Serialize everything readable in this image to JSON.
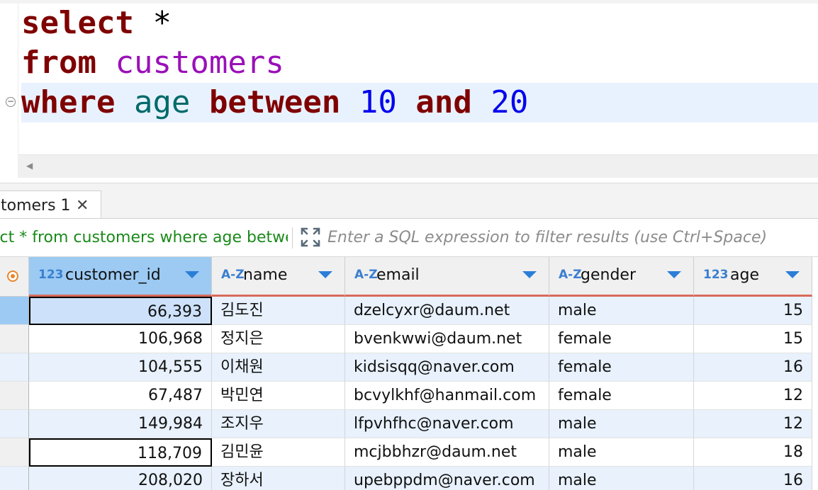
{
  "editor": {
    "lines": [
      [
        {
          "t": "select",
          "c": "kw"
        },
        {
          "t": " *",
          "c": "op"
        }
      ],
      [
        {
          "t": "from",
          "c": "kw"
        },
        {
          "t": " ",
          "c": "op"
        },
        {
          "t": "customers",
          "c": "tbl"
        }
      ],
      [
        {
          "t": "where",
          "c": "kw"
        },
        {
          "t": " ",
          "c": "op"
        },
        {
          "t": "age",
          "c": "col"
        },
        {
          "t": " ",
          "c": "op"
        },
        {
          "t": "between",
          "c": "kw"
        },
        {
          "t": " ",
          "c": "op"
        },
        {
          "t": "10",
          "c": "num"
        },
        {
          "t": " ",
          "c": "op"
        },
        {
          "t": "and",
          "c": "kw"
        },
        {
          "t": " ",
          "c": "op"
        },
        {
          "t": "20",
          "c": "num"
        }
      ]
    ],
    "fold_glyph": "−",
    "scroll_arrow": "◀"
  },
  "results": {
    "tab_label": "tomers 1",
    "close_glyph": "✕"
  },
  "filter": {
    "query_text": "ect * from customers where age betwe",
    "placeholder": "Enter a SQL expression to filter results (use Ctrl+Space)"
  },
  "grid": {
    "columns": [
      {
        "type": "123",
        "name": "customer_id"
      },
      {
        "type": "A-Z",
        "name": "name"
      },
      {
        "type": "A-Z",
        "name": "email"
      },
      {
        "type": "A-Z",
        "name": "gender"
      },
      {
        "type": "123",
        "name": "age"
      }
    ],
    "rows": [
      [
        "66,393",
        "김도진",
        "dzelcyxr@daum.net",
        "male",
        "15"
      ],
      [
        "106,968",
        "정지은",
        "bvenkwwi@daum.net",
        "female",
        "15"
      ],
      [
        "104,555",
        "이채원",
        "kidsisqq@naver.com",
        "female",
        "16"
      ],
      [
        "67,487",
        "박민연",
        "bcvylkhf@hanmail.com",
        "female",
        "12"
      ],
      [
        "149,984",
        "조지우",
        "lfpvhfhc@naver.com",
        "male",
        "12"
      ],
      [
        "118,709",
        "김민윤",
        "mcjbbhzr@daum.net",
        "male",
        "18"
      ],
      [
        "208,020",
        "장하서",
        "upebppdm@naver.com",
        "male",
        "16"
      ]
    ]
  },
  "colors": {
    "keyword": "#7f0000",
    "table": "#9a10b8",
    "column": "#006a6a",
    "number": "#0000ee",
    "query_green": "#1a8a1a",
    "header_accent": "#d86a5a",
    "selected_header": "#9ccaf3"
  }
}
